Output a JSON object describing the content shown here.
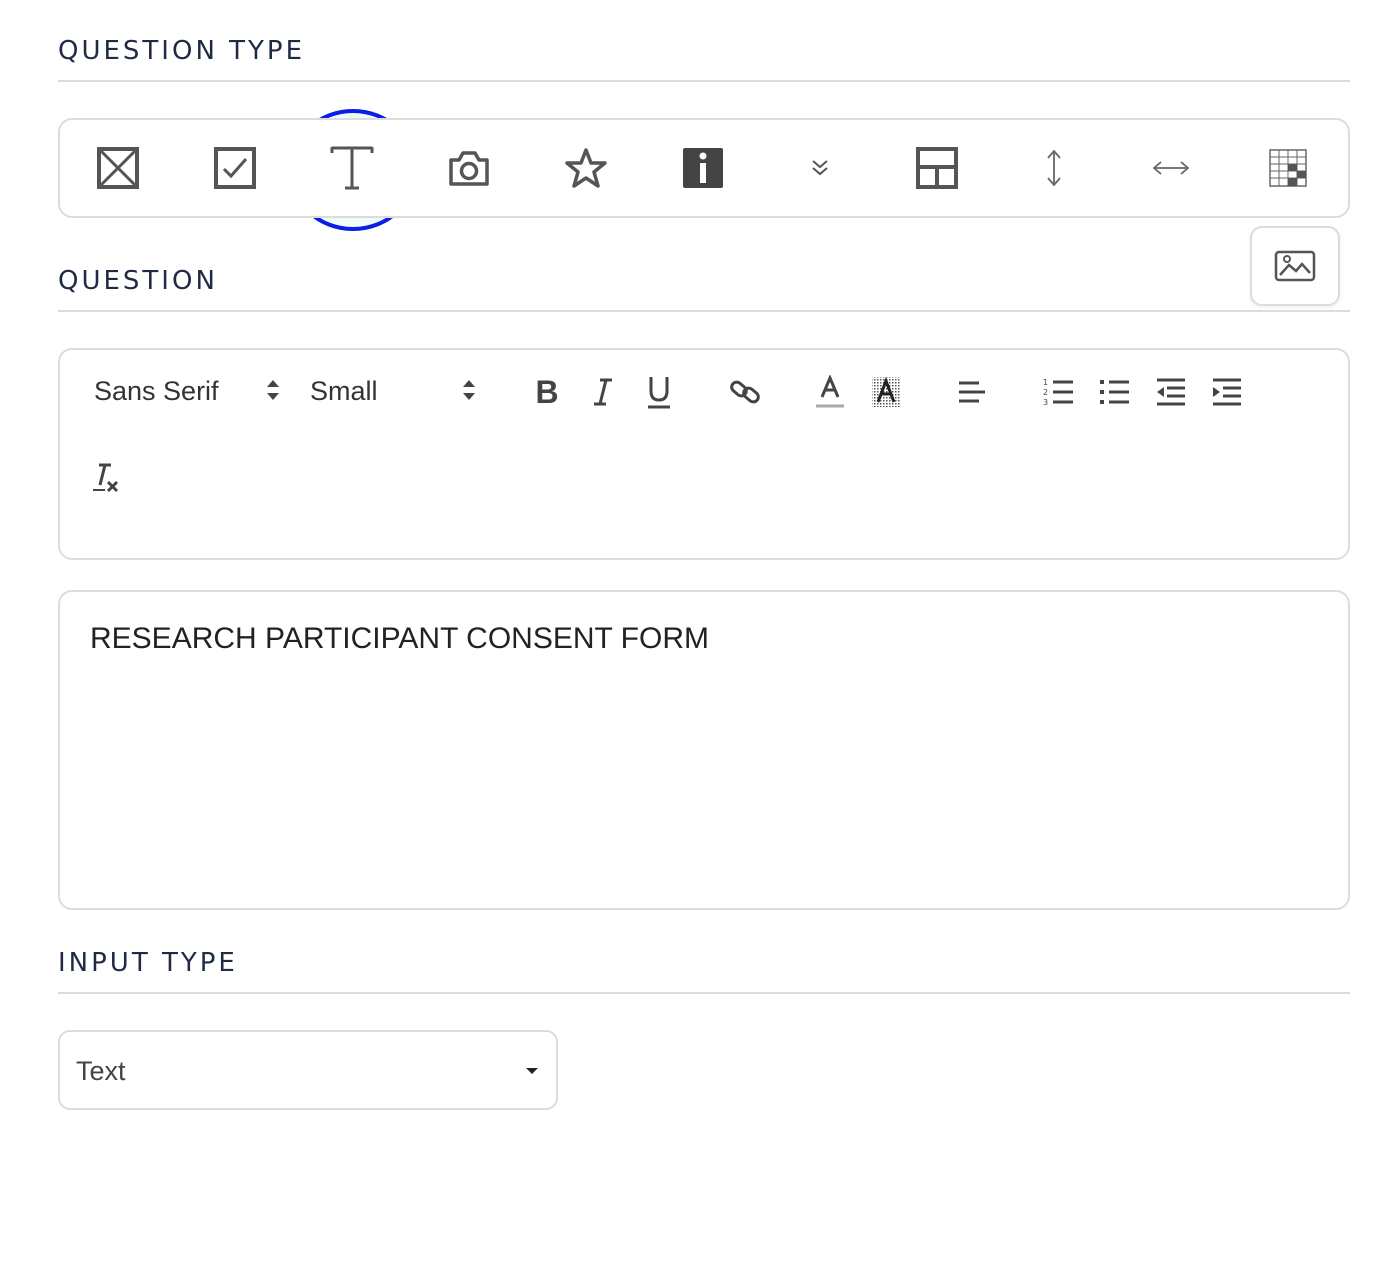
{
  "question_type": {
    "heading": "QUESTION TYPE",
    "options": [
      {
        "icon": "box-x-icon"
      },
      {
        "icon": "checkbox-icon"
      },
      {
        "icon": "text-t-icon",
        "selected": true
      },
      {
        "icon": "camera-icon"
      },
      {
        "icon": "star-icon"
      },
      {
        "icon": "info-icon"
      },
      {
        "icon": "chevron-double-down-icon"
      },
      {
        "icon": "layout-icon"
      },
      {
        "icon": "vertical-resize-icon"
      },
      {
        "icon": "horizontal-resize-icon"
      },
      {
        "icon": "grid-table-icon"
      }
    ],
    "selection_color": "#0a1ee6"
  },
  "question": {
    "heading": "QUESTION",
    "image_button_icon": "image-icon",
    "toolbar": {
      "font_family": "Sans Serif",
      "font_size": "Small",
      "buttons": [
        "bold-icon",
        "italic-icon",
        "underline-icon",
        "link-icon",
        "text-color-icon",
        "background-color-icon",
        "align-left-icon",
        "ordered-list-icon",
        "bullet-list-icon",
        "outdent-icon",
        "indent-icon",
        "clear-format-icon"
      ]
    },
    "content": "RESEARCH PARTICIPANT CONSENT FORM"
  },
  "input_type": {
    "heading": "INPUT TYPE",
    "selected": "Text"
  }
}
